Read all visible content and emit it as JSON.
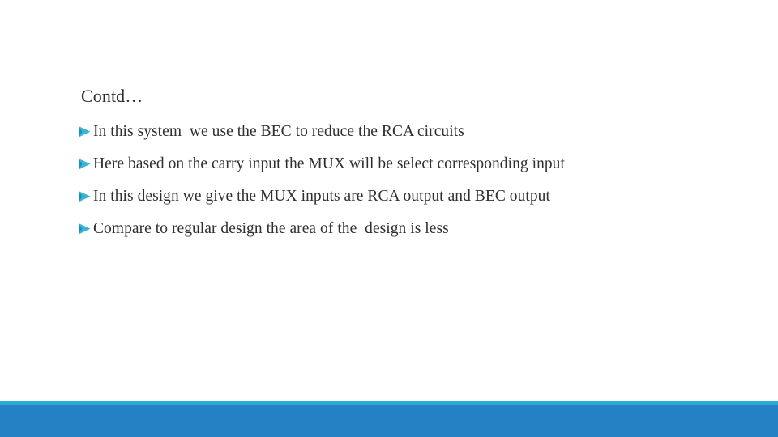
{
  "slide": {
    "title": "Contd…",
    "background_color": "#ffffff",
    "title_color": "#2b2b2b",
    "body_color": "#2f2f2f",
    "rule_color": "#4a4a4a",
    "bullet_marker_color": "#3ab4d6",
    "bullet_marker_icon": "arrowhead-bullet-icon",
    "bullets": [
      {
        "text": "In this system  we use the BEC to reduce the RCA circuits"
      },
      {
        "text": "Here based on the carry input the MUX will be select corresponding input"
      },
      {
        "text": "In this design we give the MUX inputs are RCA output and BEC output"
      },
      {
        "text": "Compare to regular design the area of the  design is less"
      }
    ]
  },
  "footer": {
    "accent_cyan": "#29abd8",
    "accent_blue": "#2580c4"
  }
}
